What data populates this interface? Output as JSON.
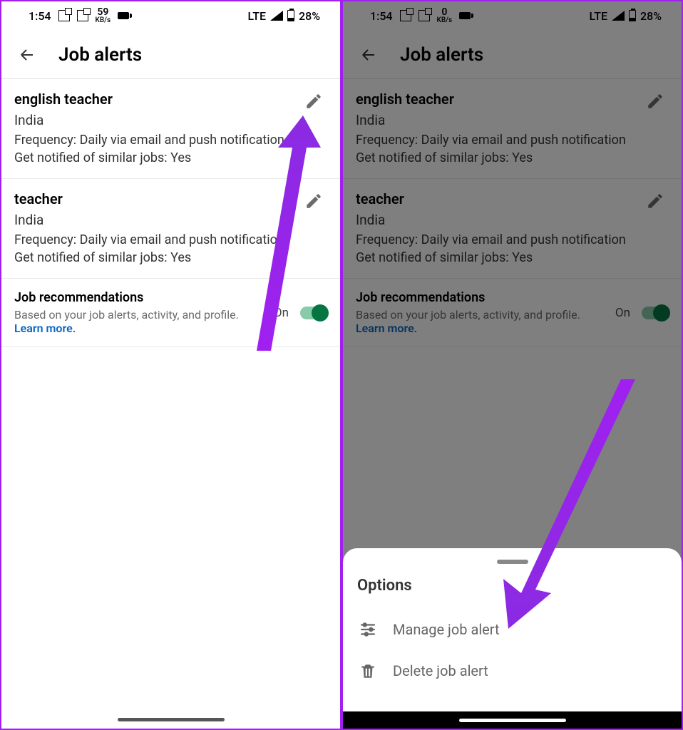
{
  "status": {
    "time": "1:54",
    "speed_left": "59",
    "speed_left_unit": "KB/s",
    "speed_right": "0",
    "speed_right_unit": "KB/s",
    "network": "LTE",
    "battery": "28%"
  },
  "header": {
    "title": "Job alerts"
  },
  "alerts": [
    {
      "title": "english teacher",
      "location": "India",
      "frequency": "Frequency: Daily via email and push notification",
      "similar": "Get notified of similar jobs: Yes"
    },
    {
      "title": "teacher",
      "location": "India",
      "frequency": "Frequency: Daily via email and push notification",
      "similar": "Get notified of similar jobs: Yes"
    }
  ],
  "recommendations": {
    "title": "Job recommendations",
    "subtitle": "Based on your job alerts, activity, and profile.",
    "link": "Learn more.",
    "state": "On"
  },
  "sheet": {
    "title": "Options",
    "manage": "Manage job alert",
    "delete": "Delete job alert"
  }
}
